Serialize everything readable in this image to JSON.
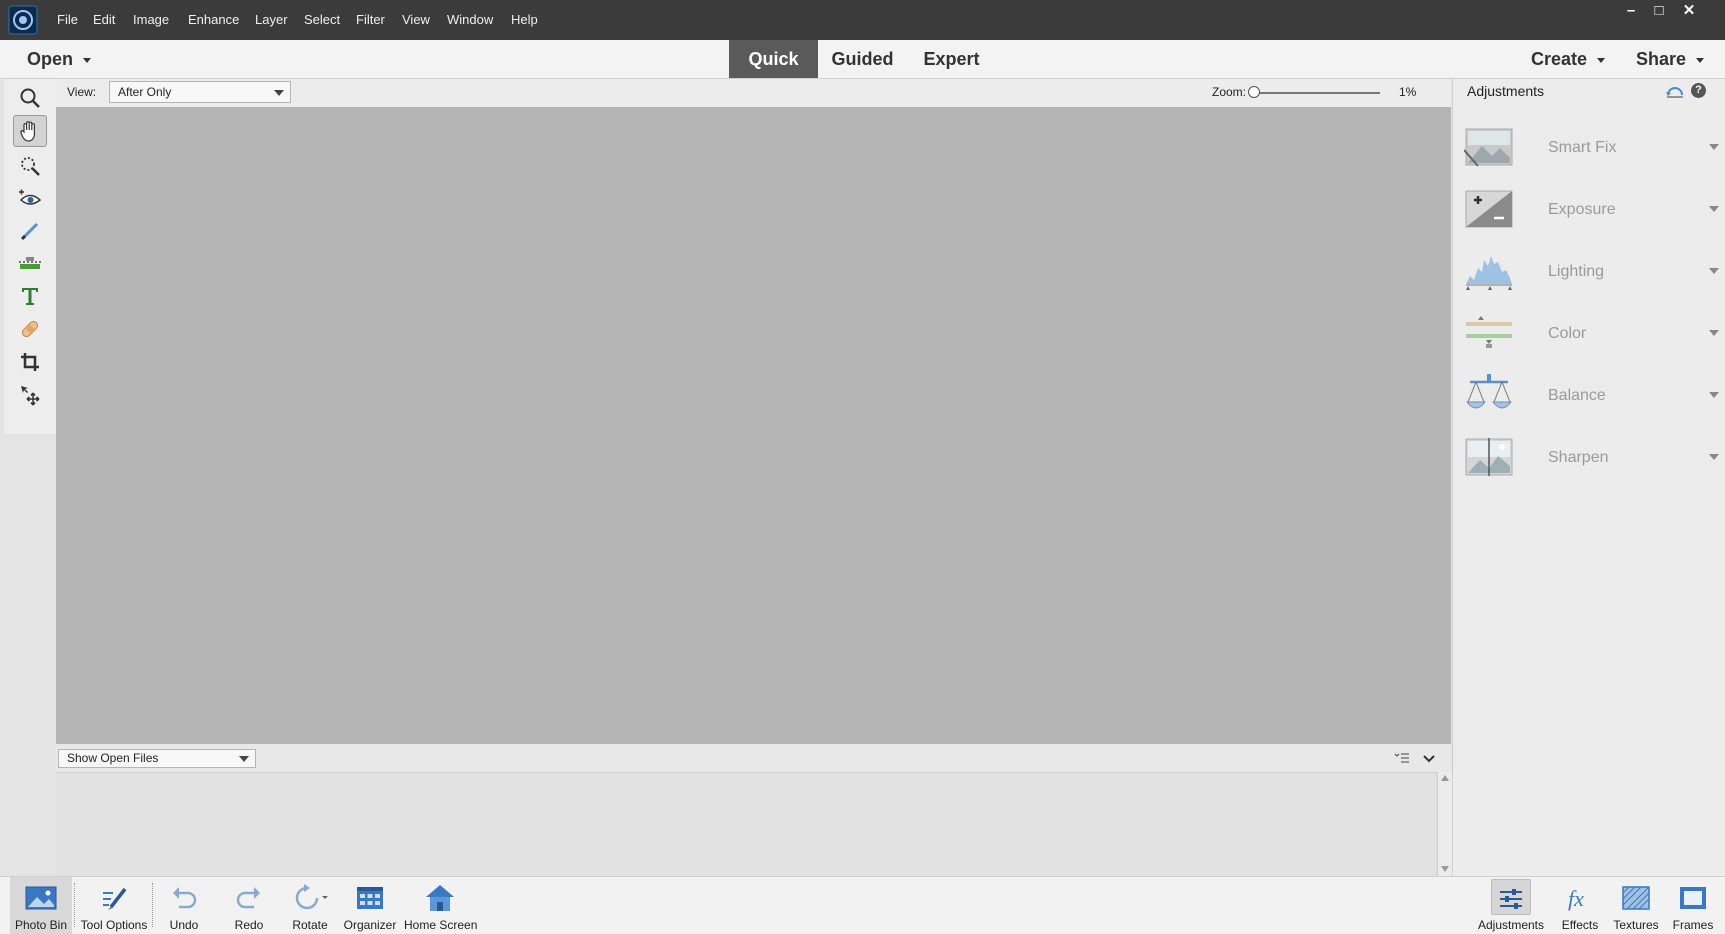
{
  "menu": [
    "File",
    "Edit",
    "Image",
    "Enhance",
    "Layer",
    "Select",
    "Filter",
    "View",
    "Window",
    "Help"
  ],
  "window_controls": {
    "minimize": "–",
    "maximize": "□",
    "close": "✕"
  },
  "modebar": {
    "open_label": "Open",
    "tabs": [
      "Quick",
      "Guided",
      "Expert"
    ],
    "active_tab": "Quick",
    "create_label": "Create",
    "share_label": "Share"
  },
  "viewbar": {
    "view_label": "View:",
    "view_value": "After Only",
    "zoom_label": "Zoom:",
    "zoom_value": "1%",
    "zoom_fraction": 0.0
  },
  "photobin": {
    "select_value": "Show Open Files"
  },
  "adjustments": {
    "title": "Adjustments",
    "items": [
      "Smart Fix",
      "Exposure",
      "Lighting",
      "Color",
      "Balance",
      "Sharpen"
    ]
  },
  "tools": [
    "zoom",
    "hand",
    "quick-selection",
    "red-eye",
    "whiten-teeth",
    "straighten",
    "type",
    "spot-healing",
    "crop",
    "move"
  ],
  "active_tool": "hand",
  "bottombar": {
    "left": [
      "Photo Bin",
      "Tool Options",
      "Undo",
      "Redo",
      "Rotate",
      "Organizer",
      "Home Screen"
    ],
    "right": [
      "Adjustments",
      "Effects",
      "Textures",
      "Frames"
    ]
  },
  "colors": {
    "accent": "#3b78c4",
    "titlebar": "#3b3b3b",
    "canvas": "#b4b4b4"
  }
}
